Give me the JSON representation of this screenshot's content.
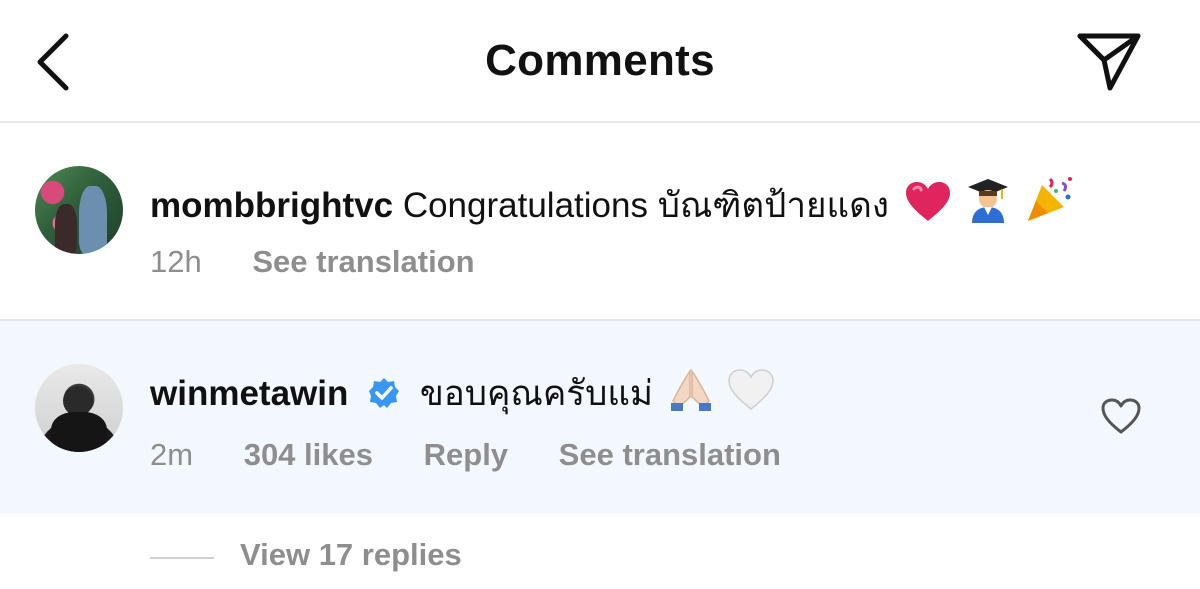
{
  "header": {
    "title": "Comments",
    "back_icon": "chevron-left-icon",
    "share_icon": "paper-plane-icon"
  },
  "comments": [
    {
      "username": "mombbrightvc",
      "verified": false,
      "text": "Congratulations บัณฑิตป้ายแดง",
      "emojis": [
        "red-heart",
        "graduate",
        "party-popper"
      ],
      "time": "12h",
      "see_translation": "See translation"
    },
    {
      "username": "winmetawin",
      "verified": true,
      "text": "ขอบคุณครับแม่",
      "emojis": [
        "folded-hands",
        "white-heart"
      ],
      "time": "2m",
      "likes": "304 likes",
      "reply": "Reply",
      "see_translation": "See translation"
    }
  ],
  "view_replies": "View 17 replies",
  "colors": {
    "highlight_bg": "#f2f8fd",
    "meta_text": "#8e8e8e",
    "verified_blue": "#3897f0",
    "heart_red": "#e0245e"
  }
}
